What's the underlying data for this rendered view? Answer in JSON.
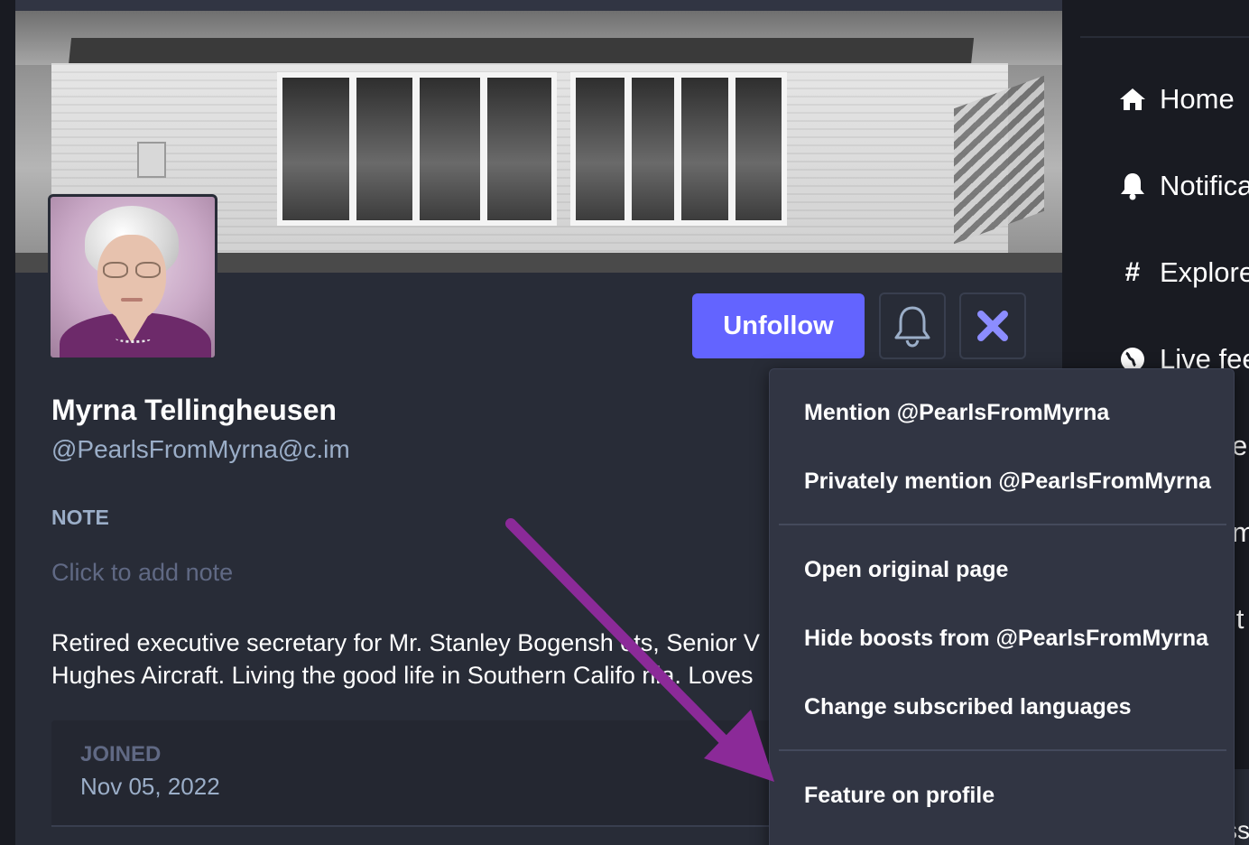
{
  "profile": {
    "display_name": "Myrna Tellingheusen",
    "handle": "@PearlsFromMyrna@c.im",
    "note_label": "NOTE",
    "note_placeholder": "Click to add note",
    "bio_line1": "Retired executive secretary for Mr. Stanley Bogensh   ots, Senior V",
    "bio_line2": "Hughes Aircraft. Living the good life in Southern Califo   nia. Loves",
    "joined_label": "JOINED",
    "joined_date": "Nov 05, 2022"
  },
  "actions": {
    "unfollow_label": "Unfollow",
    "bell_icon": "bell-icon",
    "close_icon": "close-icon",
    "accent_color": "#6364ff"
  },
  "dropdown": {
    "items": [
      "Mention @PearlsFromMyrna",
      "Privately mention @PearlsFromMyrna",
      "Open original page",
      "Hide boosts from @PearlsFromMyrna",
      "Change subscribed languages",
      "Feature on profile"
    ]
  },
  "nav": {
    "items": [
      {
        "label": "Home",
        "icon": "home-icon"
      },
      {
        "label": "Notifica",
        "icon": "bell-icon"
      },
      {
        "label": "Explore",
        "icon": "hashtag-icon"
      },
      {
        "label": "Live fee",
        "icon": "globe-icon"
      }
    ],
    "partials": [
      "e",
      "m",
      "it",
      "ss"
    ]
  },
  "annotation": {
    "arrow_color": "#8b2a98"
  }
}
